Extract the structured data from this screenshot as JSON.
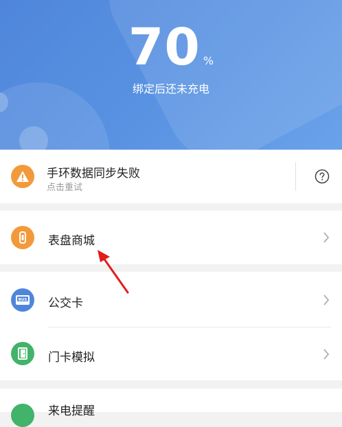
{
  "header": {
    "battery_value": "70",
    "battery_unit": "%",
    "status_text": "绑定后还未充电"
  },
  "sync": {
    "title": "手环数据同步失败",
    "subtitle": "点击重试",
    "help_icon": "question-circle-icon"
  },
  "menu": {
    "watch_face_store": "表盘商城",
    "bus_card": "公交卡",
    "door_card": "门卡模拟",
    "call_reminder": "来电提醒"
  },
  "icons": {
    "bus_badge_text": "BUS"
  },
  "colors": {
    "header_blue": "#5a93e2",
    "warning_orange": "#f29a3b",
    "watch_orange": "#f29a3b",
    "bus_blue": "#4f86db",
    "door_green": "#41b36a"
  }
}
